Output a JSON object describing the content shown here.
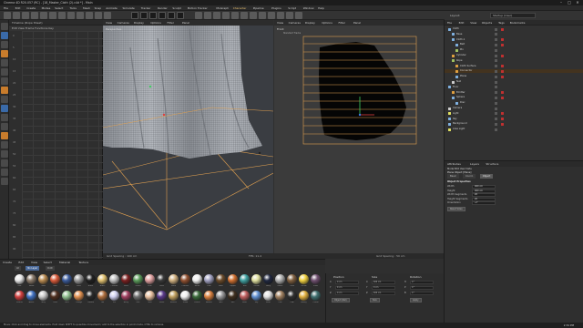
{
  "window": {
    "title": "Cinema 4D R20.057 (RC) - [18_Master_Cloth (2).c4d *] - Main",
    "buttons": [
      "–",
      "□",
      "✕"
    ]
  },
  "menu": [
    "File",
    "Edit",
    "Create",
    "Modes",
    "Select",
    "Tools",
    "Mesh",
    "Snap",
    "Animate",
    "Simulate",
    "Tracker",
    "Render",
    "Sculpt",
    "Motion Tracker",
    "MoGraph",
    "Character",
    "Pipeline",
    "Plugins",
    "Script",
    "Window",
    "Help"
  ],
  "menu_active_index": 15,
  "layout": {
    "label": "Layout:",
    "value": "Startup (User)"
  },
  "timeline": {
    "title": "Timeline (Dope Sheet)",
    "menu": "Edit  View  Frame  Functions  Key",
    "row_numbers": [
      "0",
      "5",
      "10",
      "15",
      "20",
      "25",
      "30",
      "35",
      "40",
      "45",
      "50",
      "55",
      "60",
      "65",
      "70",
      "75",
      "80",
      "85",
      "90"
    ]
  },
  "viewport_left": {
    "menu": [
      "View",
      "Cameras",
      "Display",
      "Options",
      "Filter",
      "Panel"
    ],
    "label": "Perspective",
    "footer_left": "Grid Spacing : 100 cm",
    "footer_right": "FPS: 11.4"
  },
  "viewport_right": {
    "menu": [
      "View",
      "Cameras",
      "Display",
      "Options",
      "Filter",
      "Panel"
    ],
    "label": "Front",
    "sub_label": "Standard Tracks",
    "footer_right": "Grid Spacing : 50 cm"
  },
  "object_manager": {
    "menu": [
      "File",
      "Edit",
      "View",
      "Objects",
      "Tags",
      "Bookmarks"
    ],
    "rows": [
      {
        "name": "Cloth",
        "color": "#7fb0e0",
        "indent": 0,
        "tag": true
      },
      {
        "name": "Base",
        "color": "#7fb0e0",
        "indent": 1,
        "tag": false
      },
      {
        "name": "Cloth.1",
        "color": "#7fb0e0",
        "indent": 1,
        "tag": true
      },
      {
        "name": "Belt",
        "color": "#7fb0e0",
        "indent": 2,
        "tag": true
      },
      {
        "name": "Pin",
        "color": "#a0c060",
        "indent": 2,
        "tag": false
      },
      {
        "name": "Cylinder",
        "color": "#e0a040",
        "indent": 1,
        "tag": true
      },
      {
        "name": "Rope",
        "color": "#a0c060",
        "indent": 1,
        "tag": false
      },
      {
        "name": "Cloth Surface",
        "color": "#e0a040",
        "indent": 2,
        "tag": true
      },
      {
        "name": "Connector",
        "color": "#e0a040",
        "indent": 2,
        "tag": true
      },
      {
        "name": "Plane",
        "color": "#7fb0e0",
        "indent": 2,
        "tag": true
      },
      {
        "name": "Null",
        "color": "#cccccc",
        "indent": 1,
        "tag": false
      },
      {
        "name": "Floor",
        "color": "#7fb0e0",
        "indent": 0,
        "tag": false
      },
      {
        "name": "Emitter",
        "color": "#e0a040",
        "indent": 1,
        "tag": true
      },
      {
        "name": "Sphere",
        "color": "#7fb0e0",
        "indent": 1,
        "tag": true
      },
      {
        "name": "Disc",
        "color": "#7fb0e0",
        "indent": 2,
        "tag": false
      },
      {
        "name": "Camera",
        "color": "#cccccc",
        "indent": 0,
        "tag": false
      },
      {
        "name": "Light",
        "color": "#e0e060",
        "indent": 0,
        "tag": true
      },
      {
        "name": "Sky",
        "color": "#7fb0e0",
        "indent": 0,
        "tag": true
      },
      {
        "name": "Background",
        "color": "#7fb0e0",
        "indent": 0,
        "tag": true
      },
      {
        "name": "Area Light",
        "color": "#e0e060",
        "indent": 0,
        "tag": false
      }
    ],
    "selected_index": 8
  },
  "attributes": {
    "menu": [
      "Attributes",
      "Layers",
      "Structure"
    ],
    "submenu": "Mode  Edit  User Data",
    "object_label": "Plane Object [Plane]",
    "tabs": [
      "Basic",
      "Coord.",
      "Object"
    ],
    "active_tab": 2,
    "section": "Object Properties",
    "rows": [
      {
        "label": "Width",
        "value": "400 cm"
      },
      {
        "label": "Height",
        "value": "400 cm"
      },
      {
        "label": "Width Segments",
        "value": "20"
      },
      {
        "label": "Height Segments",
        "value": "20"
      },
      {
        "label": "Orientation",
        "value": "+Y"
      }
    ],
    "button": "Reset Sizes"
  },
  "materials": {
    "menu": [
      "Create",
      "Edit",
      "View",
      "Select",
      "Material",
      "Texture"
    ],
    "filters": [
      "All",
      "No Layer",
      "Cloth"
    ],
    "swatches": [
      {
        "color": "#e8e8e8",
        "label": "Mat"
      },
      {
        "color": "#8a7a6a",
        "label": "Wood"
      },
      {
        "color": "#b88a50",
        "label": "Gold"
      },
      {
        "color": "#d85a3a",
        "label": "Red"
      },
      {
        "color": "#3a5a9a",
        "label": "Blue"
      },
      {
        "color": "#9a9a9a",
        "label": "Steel"
      },
      {
        "color": "#202020",
        "label": "Black"
      },
      {
        "color": "#e0c070",
        "label": "Brass"
      },
      {
        "color": "#c0c0c0",
        "label": "Chrome"
      },
      {
        "color": "#7a2020",
        "label": "Wine"
      },
      {
        "color": "#5a9a5a",
        "label": "Green"
      },
      {
        "color": "#e0a0a0",
        "label": "Pink"
      },
      {
        "color": "#3a3a3a",
        "label": "Dark"
      },
      {
        "color": "#d0b080",
        "label": "Sand"
      },
      {
        "color": "#905030",
        "label": "Leather"
      },
      {
        "color": "#f0f0f0",
        "label": "White"
      },
      {
        "color": "#a0a0c0",
        "label": "Lilac"
      },
      {
        "color": "#6a4a2a",
        "label": "Bark"
      },
      {
        "color": "#d07030",
        "label": "Copper"
      },
      {
        "color": "#40a0a0",
        "label": "Teal"
      },
      {
        "color": "#e0e0a0",
        "label": "Cream"
      },
      {
        "color": "#202840",
        "label": "Navy"
      },
      {
        "color": "#b0b0b0",
        "label": "Matte"
      },
      {
        "color": "#806040",
        "label": "Cloth"
      },
      {
        "color": "#f0d040",
        "label": "Yellow"
      },
      {
        "color": "#705070",
        "label": "Plum"
      },
      {
        "color": "#d04040",
        "label": "Scarlet"
      },
      {
        "color": "#4070c0",
        "label": "Azure"
      },
      {
        "color": "#c8c8c8",
        "label": "Grey"
      },
      {
        "color": "#503020",
        "label": "Choc"
      },
      {
        "color": "#90c090",
        "label": "Mint"
      },
      {
        "color": "#e09050",
        "label": "Orange"
      },
      {
        "color": "#2a2a2a",
        "label": "Carbon"
      },
      {
        "color": "#b07040",
        "label": "Tan"
      },
      {
        "color": "#d0d0f0",
        "label": "Ice"
      },
      {
        "color": "#a04060",
        "label": "Berry"
      },
      {
        "color": "#707070",
        "label": "Iron"
      },
      {
        "color": "#e8c0a0",
        "label": "Skin"
      },
      {
        "color": "#5a3a8a",
        "label": "Violet"
      },
      {
        "color": "#c0a060",
        "label": "Bronze"
      },
      {
        "color": "#f0f0f0",
        "label": "Snow"
      },
      {
        "color": "#3a6a3a",
        "label": "Forest"
      },
      {
        "color": "#d88040",
        "label": "Amber"
      },
      {
        "color": "#98989a",
        "label": "Ash"
      },
      {
        "color": "#403020",
        "label": "Soil"
      },
      {
        "color": "#c06060",
        "label": "Rose"
      },
      {
        "color": "#6090d0",
        "label": "Sky"
      },
      {
        "color": "#e0e0e0",
        "label": "Pearl"
      },
      {
        "color": "#a08060",
        "label": "Oak"
      },
      {
        "color": "#303030",
        "label": "Coal"
      },
      {
        "color": "#e0b040",
        "label": "Honey"
      },
      {
        "color": "#407070",
        "label": "Ocean"
      }
    ]
  },
  "coordinates": {
    "headers": [
      "Position",
      "Size",
      "Rotation"
    ],
    "rows": [
      {
        "axis": "X",
        "pos": "0 cm",
        "size": "400 cm",
        "rot_label": "H",
        "rot": "0 °"
      },
      {
        "axis": "Y",
        "pos": "0 cm",
        "size": "0 cm",
        "rot_label": "P",
        "rot": "0 °"
      },
      {
        "axis": "Z",
        "pos": "0 cm",
        "size": "400 cm",
        "rot_label": "B",
        "rot": "0 °"
      }
    ],
    "mode": "Object (Rel)",
    "size_mode": "Size",
    "apply": "Apply"
  },
  "status": {
    "text": "Move: Click and drag to move elements. Hold down SHIFT to quantize movement / add to the selection in point mode, CTRL to remove.",
    "time": "2:34 PM"
  },
  "colors": {
    "accent": "#d8a050",
    "grid_orange": "#e0a050",
    "cloth_grey": "#9a9ea4"
  }
}
